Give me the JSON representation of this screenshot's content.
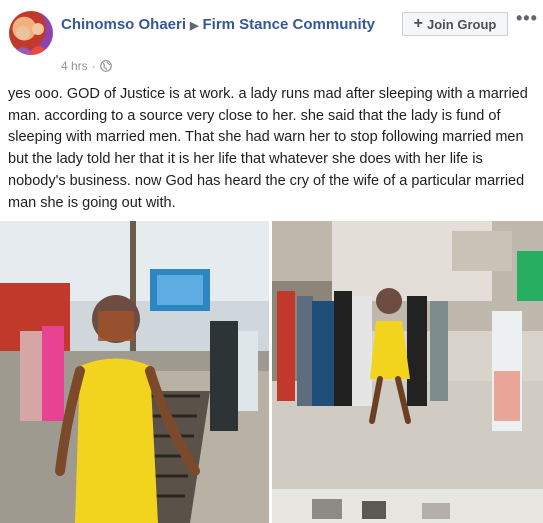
{
  "post": {
    "author": "Chinomso Ohaeri",
    "group_name": "Firm Stance Community",
    "time": "4 hrs",
    "privacy_icon": "globe-icon",
    "join_label": "Join Group",
    "more_icon": "more-options-icon",
    "text": "yes ooo. GOD of Justice is at work. a lady runs mad after sleeping with a married man. according to a source very close to her. she said that the lady is fund of sleeping with married men. That she had warn her to stop following married men but the lady told her that it is her life that whatever she does with her life is nobody's business. now God has heard the cry of the wife of a particular married man she is going out with."
  },
  "colors": {
    "link": "#365899",
    "meta": "#90949c",
    "dress": "#f2d41f"
  }
}
